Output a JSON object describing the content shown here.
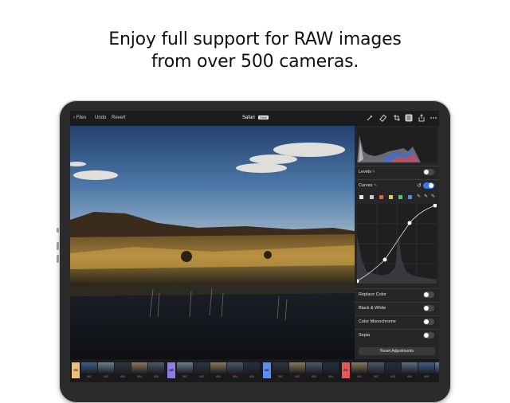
{
  "headline": {
    "line1": "Enjoy full support for RAW images",
    "line2": "from over 500 cameras."
  },
  "toolbar": {
    "back_label": "Files",
    "undo_label": "Undo",
    "revert_label": "Revert",
    "title": "Safari",
    "badge": "RAW",
    "icons": [
      "brush-icon",
      "eraser-icon",
      "crop-icon",
      "adjust-icon",
      "share-icon",
      "more-icon"
    ]
  },
  "panel": {
    "levels_label": "Levels",
    "curves_label": "Curves",
    "replace_color_label": "Replace Color",
    "black_white_label": "Black & White",
    "color_mono_label": "Color Monochrome",
    "sepia_label": "Sepia",
    "reset_label": "Reset Adjustments",
    "levels_on": false,
    "curves_on": true,
    "accent": "#2f7bf5",
    "channel_colors": [
      "#e6e6e8",
      "#c8c8c8",
      "#e0604a",
      "#e3c94a",
      "#5cc46a",
      "#4a8de3"
    ]
  },
  "filmstrip": {
    "groups": [
      {
        "tag": "VN",
        "color": "#e8c27a",
        "numbers": [
          "001",
          "002",
          "003",
          "004",
          "005"
        ]
      },
      {
        "tag": "UR",
        "color": "#8e7be3",
        "numbers": [
          "001",
          "002",
          "003",
          "004",
          "005"
        ]
      },
      {
        "tag": "NK",
        "color": "#5b8ef0",
        "numbers": [
          "001",
          "002",
          "003",
          "004"
        ]
      },
      {
        "tag": "FC",
        "color": "#e05a5a",
        "numbers": [
          "001",
          "002",
          "003",
          "004",
          "005",
          "006",
          "007"
        ]
      }
    ]
  }
}
